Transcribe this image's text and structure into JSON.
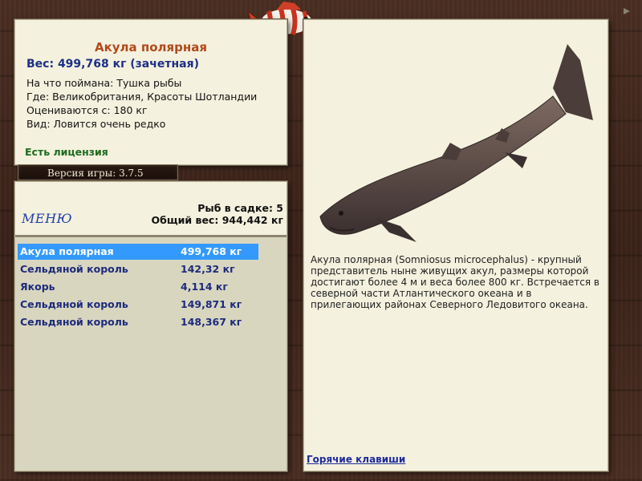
{
  "fish": {
    "name": "Акула полярная",
    "weight": "Вес: 499,768 кг (зачетная)",
    "bait": "На что поймана: Тушка рыбы",
    "location": "Где: Великобритания, Красоты Шотландии",
    "valued": "Оцениваются с: 180 кг",
    "rarity": "Вид: Ловится очень редко",
    "license": "Есть лицензия"
  },
  "version": "Версия игры: 3.7.5",
  "menu": {
    "label": "МЕНЮ"
  },
  "cage": {
    "count": "Рыб в садке: 5",
    "total": "Общий вес: 944,442 кг"
  },
  "catches": [
    {
      "name": "Акула полярная",
      "weight": "499,768 кг",
      "selected": true
    },
    {
      "name": "Сельдяной король",
      "weight": "142,32 кг",
      "selected": false
    },
    {
      "name": "Якорь",
      "weight": "4,114 кг",
      "selected": false
    },
    {
      "name": "Сельдяной король",
      "weight": "149,871 кг",
      "selected": false
    },
    {
      "name": "Сельдяной король",
      "weight": "148,367 кг",
      "selected": false
    }
  ],
  "description": "Акула полярная (Somniosus microcephalus) - крупный представитель ныне живущих акул, размеры которой достигают более 4 м и веса более 800 кг. Встречается в северной части Атлантического океана и в прилегающих районах Северного Ледовитого океана.",
  "hotkeys": "Горячие клавиши",
  "colors": {
    "title": "#b04a1c",
    "weight": "#1d2f86",
    "license": "#1f6b1f",
    "selection": "#3399ff",
    "panel": "#f4f1de",
    "wood": "#3a2219"
  },
  "icons": {
    "logo": "striped-fish-logo-icon",
    "corner": "arrow-icon"
  }
}
